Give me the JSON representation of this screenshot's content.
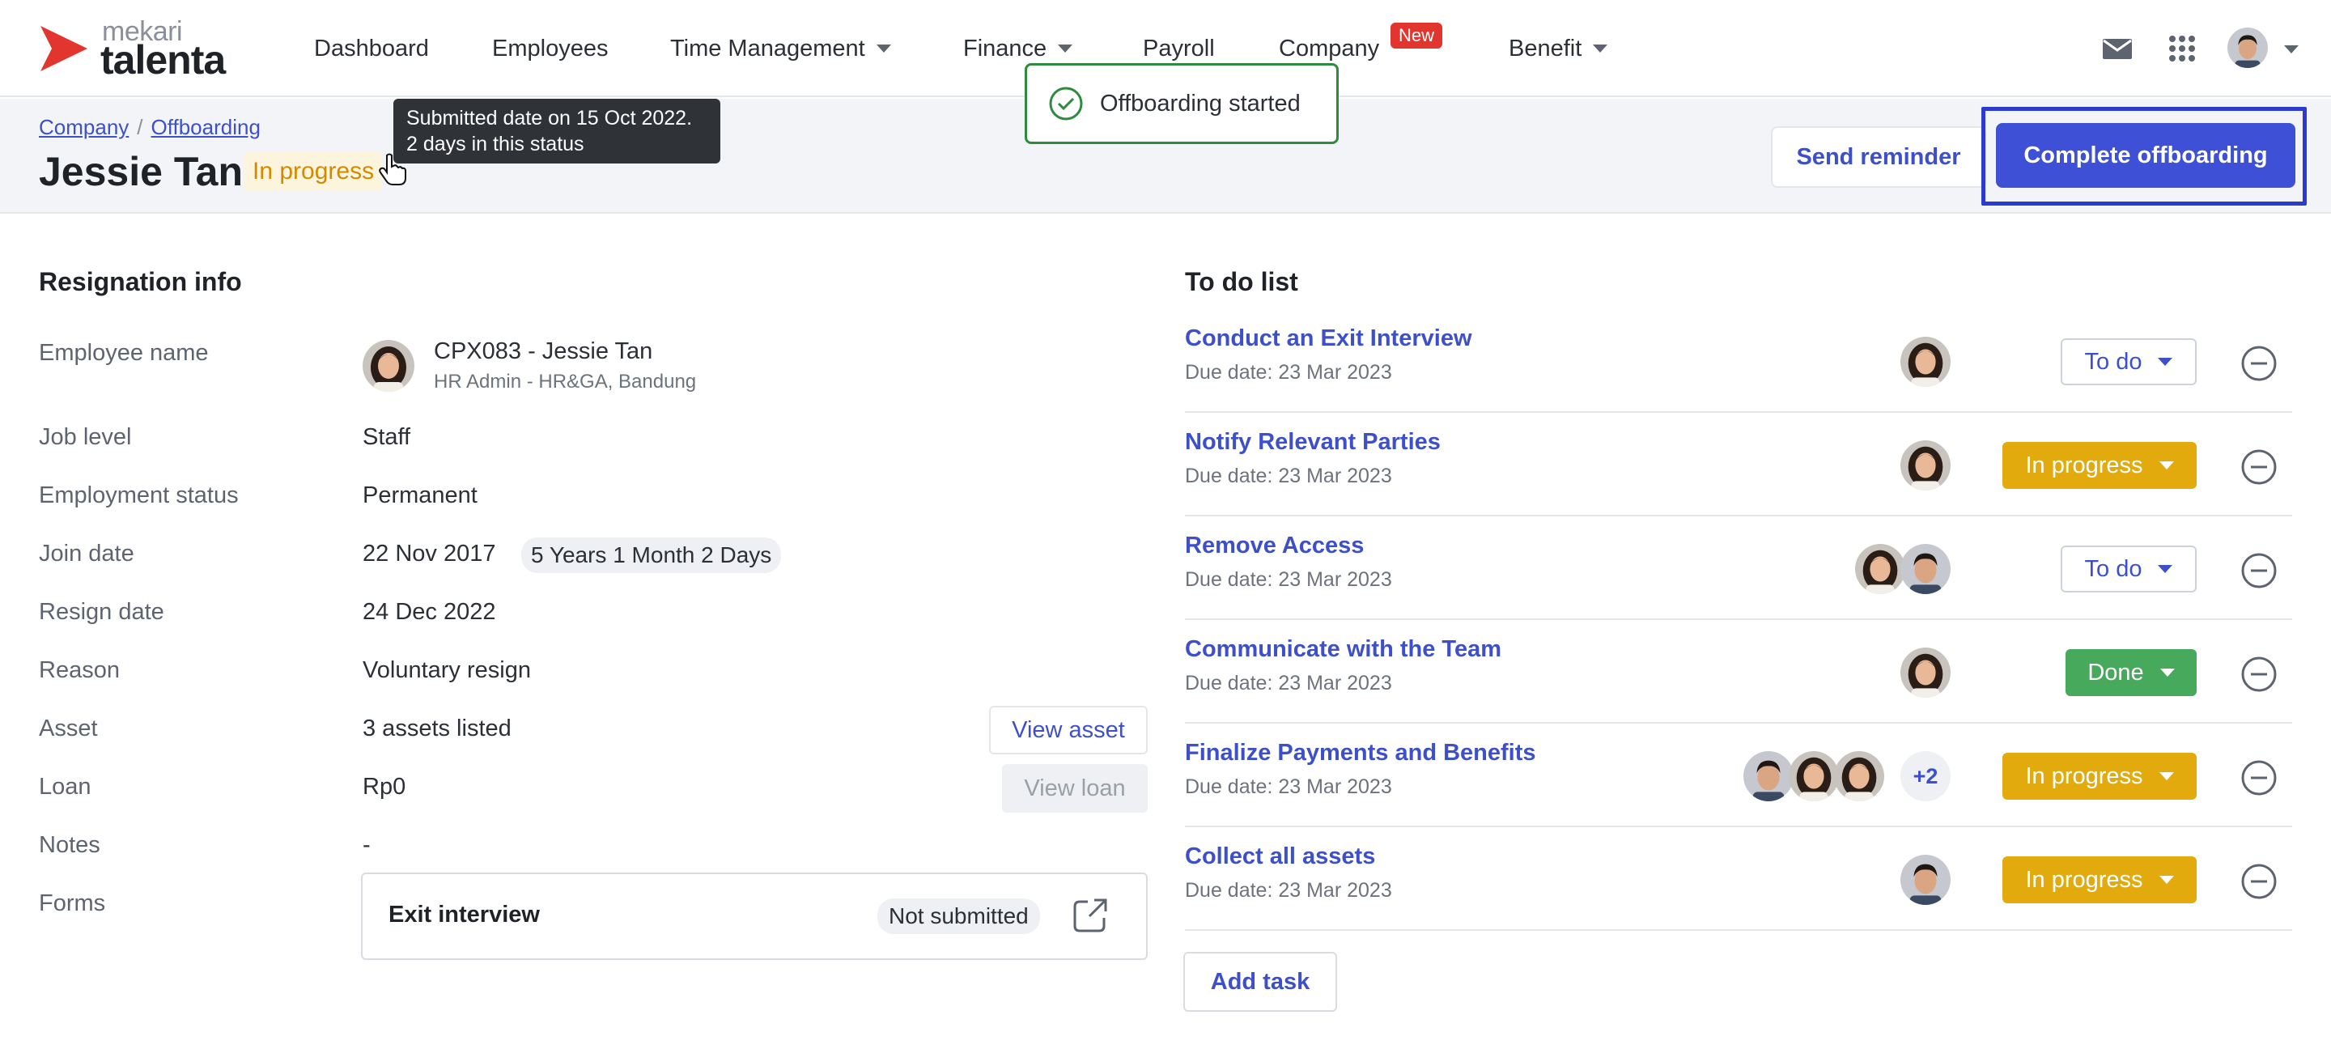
{
  "brand": {
    "small": "mekari",
    "big": "talenta",
    "accent": "#e1352e"
  },
  "nav": {
    "items": [
      {
        "label": "Dashboard"
      },
      {
        "label": "Employees"
      },
      {
        "label": "Time Management"
      },
      {
        "label": "Finance"
      },
      {
        "label": "Payroll"
      },
      {
        "label": "Company"
      },
      {
        "label": "Benefit"
      }
    ],
    "new_badge": "New",
    "icons": [
      "mail-icon",
      "apps-grid-icon",
      "user-avatar"
    ]
  },
  "toast": {
    "message": "Offboarding started",
    "color": "#2e8b3e"
  },
  "breadcrumb": {
    "company": "Company",
    "separator": "/",
    "offboarding": "Offboarding"
  },
  "header": {
    "title": "Jessie Tan",
    "status": "In progress",
    "tooltip_line1": "Submitted date on 15 Oct 2022.",
    "tooltip_line2": "2 days in this status",
    "send_reminder": "Send reminder",
    "complete": "Complete offboarding",
    "primary_color": "#3d50d6"
  },
  "resignation": {
    "title": "Resignation info",
    "employee_label": "Employee name",
    "employee_code": "CPX083 - Jessie Tan",
    "employee_role": "HR Admin - HR&GA, Bandung",
    "job_level_label": "Job level",
    "job_level": "Staff",
    "employment_label": "Employment status",
    "employment": "Permanent",
    "join_label": "Join date",
    "join_date": "22 Nov 2017",
    "tenure": "5 Years 1 Month 2 Days",
    "resign_label": "Resign date",
    "resign_date": "24 Dec 2022",
    "reason_label": "Reason",
    "reason": "Voluntary resign",
    "asset_label": "Asset",
    "asset": "3 assets listed",
    "view_asset": "View asset",
    "loan_label": "Loan",
    "loan": "Rp0",
    "view_loan": "View loan",
    "notes_label": "Notes",
    "notes": "-",
    "forms_label": "Forms",
    "form_name": "Exit interview",
    "form_status": "Not submitted"
  },
  "todo": {
    "title": "To do list",
    "tasks": [
      {
        "title": "Conduct an Exit Interview",
        "due": "Due date: 23 Mar 2023",
        "status": "To do"
      },
      {
        "title": "Notify Relevant Parties",
        "due": "Due date: 23 Mar 2023",
        "status": "In progress"
      },
      {
        "title": "Remove Access",
        "due": "Due date: 23 Mar 2023",
        "status": "To do"
      },
      {
        "title": "Communicate with the Team",
        "due": "Due date: 23 Mar 2023",
        "status": "Done"
      },
      {
        "title": "Finalize Payments and Benefits",
        "due": "Due date: 23 Mar 2023",
        "status": "In progress",
        "extra_assignees": "+2"
      },
      {
        "title": "Collect all assets",
        "due": "Due date: 23 Mar 2023",
        "status": "In progress"
      }
    ],
    "add_task": "Add task",
    "status_colors": {
      "todo": "#3d50c9",
      "in_progress": "#e3aa0e",
      "done": "#46a95c"
    }
  }
}
